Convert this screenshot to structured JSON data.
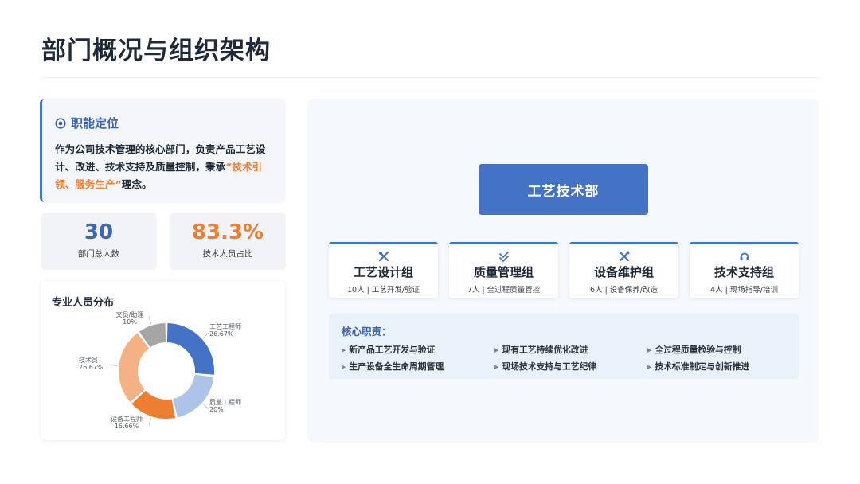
{
  "page": {
    "title": "部门概况与组织架构"
  },
  "role": {
    "heading": "职能定位",
    "text_before": "作为公司技术管理的核心部门，负责产品工艺设计、改进、技术支持及质量控制，秉承",
    "highlight": "“技术引领、服务生产”",
    "text_after": "理念。"
  },
  "stats": [
    {
      "value": "30",
      "label": "部门总人数"
    },
    {
      "value": "83.3%",
      "label": "技术人员占比"
    }
  ],
  "chart_data": {
    "type": "pie",
    "title": "专业人员分布",
    "slices": [
      {
        "name": "工艺工程师",
        "value": 26.67,
        "label": "26.67%",
        "color": "#4472c4"
      },
      {
        "name": "质量工程师",
        "value": 20,
        "label": "20%",
        "color": "#aec3e8"
      },
      {
        "name": "设备工程师",
        "value": 16.66,
        "label": "16.66%",
        "color": "#ed7d31"
      },
      {
        "name": "技术员",
        "value": 26.67,
        "label": "26.67%",
        "color": "#f4b183"
      },
      {
        "name": "文员/助理",
        "value": 10,
        "label": "10%",
        "color": "#a5a5a5"
      }
    ]
  },
  "org": {
    "department": "工艺技术部",
    "groups": [
      {
        "name": "工艺设计组",
        "desc": "10人 | 工艺开发/验证",
        "icon": "tools-icon"
      },
      {
        "name": "质量管理组",
        "desc": "7人 | 全过程质量管控",
        "icon": "check-icon"
      },
      {
        "name": "设备维护组",
        "desc": "6人 | 设备保养/改造",
        "icon": "wrench-icon"
      },
      {
        "name": "技术支持组",
        "desc": "4人 | 现场指导/培训",
        "icon": "headset-icon"
      }
    ],
    "duties_title": "核心职责：",
    "duties": [
      "新产品工艺开发与验证",
      "现有工艺持续优化改进",
      "全过程质量检验与控制",
      "生产设备全生命周期管理",
      "现场技术支持与工艺纪律",
      "技术标准制定与创新推进"
    ]
  },
  "colors": {
    "accent": "#4472c4",
    "highlight": "#ed7d31"
  }
}
